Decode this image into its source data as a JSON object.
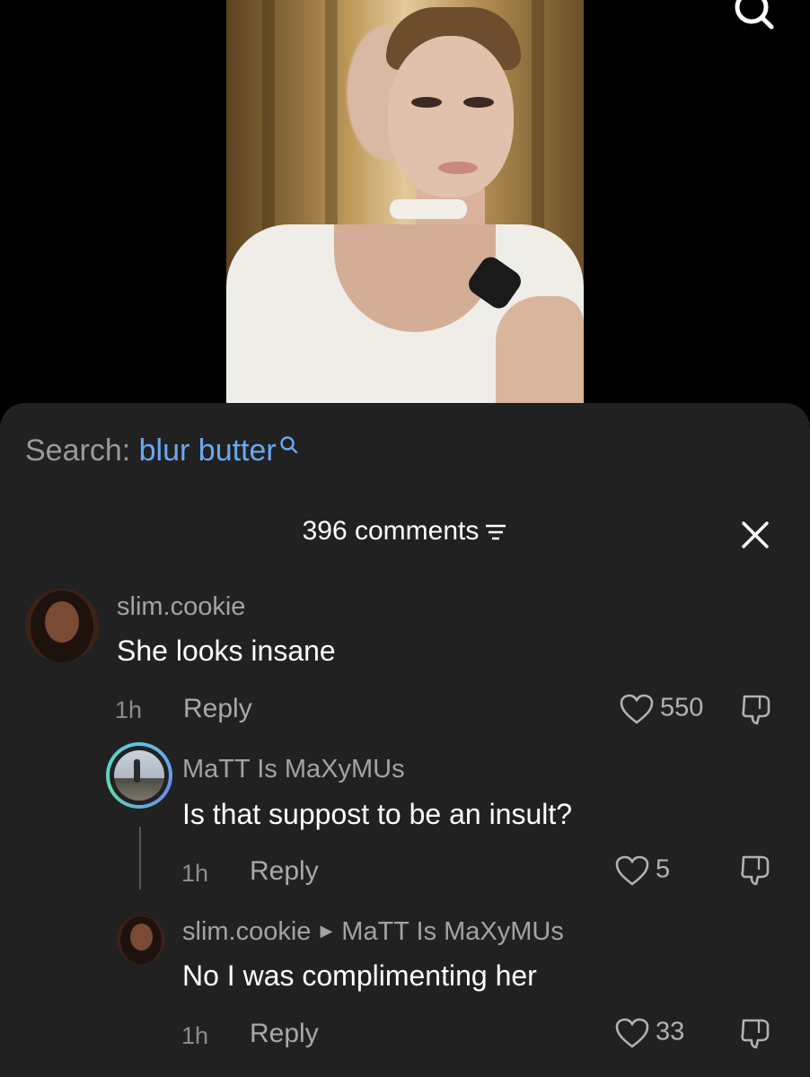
{
  "search": {
    "label": "Search:",
    "query": "blur butter",
    "icon": "search-icon"
  },
  "header": {
    "comment_count": "396 comments",
    "sort_icon": "filter-lines-icon",
    "close_icon": "close-icon"
  },
  "comments": [
    {
      "username": "slim.cookie",
      "text": "She looks insane",
      "time": "1h",
      "reply_label": "Reply",
      "likes": "550"
    },
    {
      "username": "MaTT Is MaXyMUs",
      "text": "Is that suppost to be an insult?",
      "time": "1h",
      "reply_label": "Reply",
      "likes": "5"
    },
    {
      "username": "slim.cookie",
      "reply_to": "MaTT Is MaXyMUs",
      "text": "No I was complimenting her",
      "time": "1h",
      "reply_label": "Reply",
      "likes": "33"
    }
  ],
  "colors": {
    "panel": "#212121",
    "search_query": "#6aa9f0",
    "ring": "#5cc7e8"
  }
}
